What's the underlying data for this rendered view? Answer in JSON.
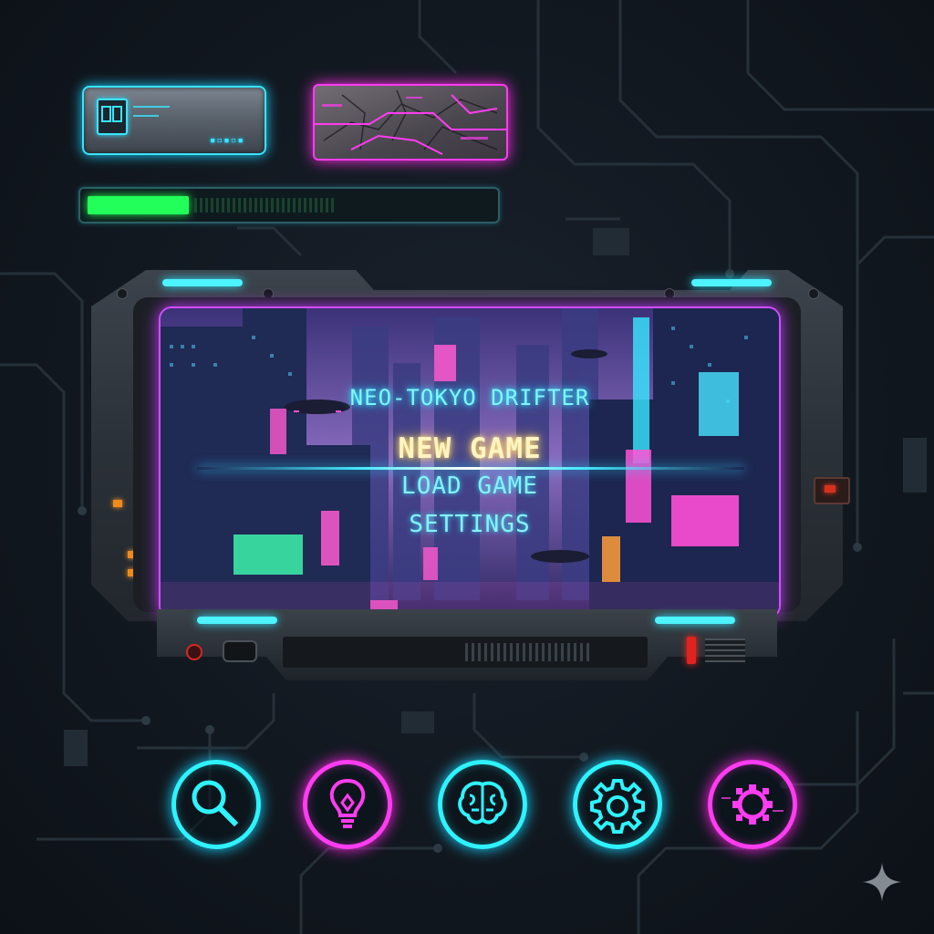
{
  "game": {
    "title": "NEO-TOKYO DRIFTER"
  },
  "main_menu": {
    "items": [
      {
        "label": "NEW GAME",
        "selected": true
      },
      {
        "label": "LOAD GAME",
        "selected": false
      },
      {
        "label": "SETTINGS",
        "selected": false
      }
    ]
  },
  "hud": {
    "badge_code": "▪▫▪▫▪",
    "progress_fraction": 0.25
  },
  "toolbar": {
    "icons": [
      {
        "name": "search-icon",
        "color": "#2ef3ff"
      },
      {
        "name": "lightbulb-icon",
        "color": "#ff3cf0"
      },
      {
        "name": "brain-icon",
        "color": "#2ef3ff"
      },
      {
        "name": "gear-icon",
        "color": "#2ef3ff"
      },
      {
        "name": "glitch-gear-icon",
        "color": "#ff3cf0"
      }
    ]
  },
  "colors": {
    "accent_cyan": "#2ef3ff",
    "accent_magenta": "#ff3cf0",
    "progress_green": "#22ff5a",
    "selected_text": "#fff4c2"
  }
}
